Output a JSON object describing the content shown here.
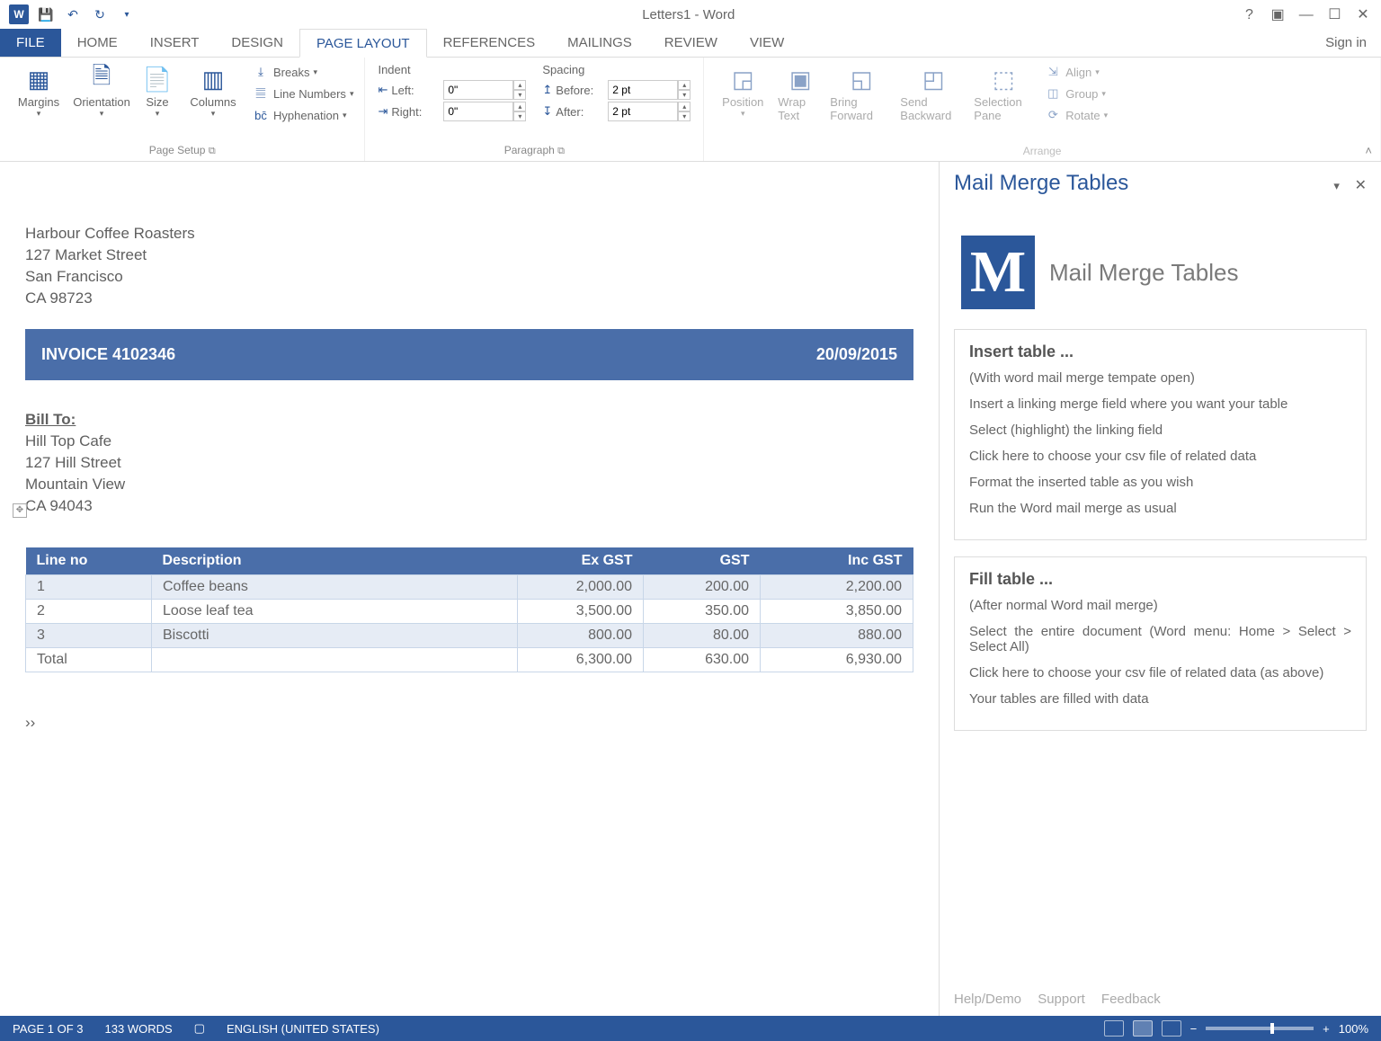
{
  "title": "Letters1 - Word",
  "signin": "Sign in",
  "tabs": [
    "FILE",
    "HOME",
    "INSERT",
    "DESIGN",
    "PAGE LAYOUT",
    "REFERENCES",
    "MAILINGS",
    "REVIEW",
    "VIEW"
  ],
  "active_tab_index": 4,
  "ribbon": {
    "groups": {
      "page_setup": {
        "label": "Page Setup",
        "margins": "Margins",
        "orientation": "Orientation",
        "size": "Size",
        "columns": "Columns",
        "breaks": "Breaks",
        "line_numbers": "Line Numbers",
        "hyphenation": "Hyphenation"
      },
      "paragraph": {
        "label": "Paragraph",
        "indent_label": "Indent",
        "left_label": "Left:",
        "right_label": "Right:",
        "left_value": "0\"",
        "right_value": "0\"",
        "spacing_label": "Spacing",
        "before_label": "Before:",
        "after_label": "After:",
        "before_value": "2 pt",
        "after_value": "2 pt"
      },
      "arrange": {
        "label": "Arrange",
        "position": "Position",
        "wrap": "Wrap Text",
        "forward": "Bring Forward",
        "backward": "Send Backward",
        "selpane": "Selection Pane",
        "align": "Align",
        "group": "Group",
        "rotate": "Rotate"
      }
    }
  },
  "document": {
    "sender": [
      "Harbour Coffee Roasters",
      "127 Market Street",
      "San Francisco",
      "CA 98723"
    ],
    "invoice_label": "INVOICE 4102346",
    "invoice_date": "20/09/2015",
    "bill_to_label": "Bill To:",
    "bill_to": [
      "Hill Top Cafe",
      "127 Hill Street",
      "Mountain View",
      "CA 94043"
    ],
    "table": {
      "headers": [
        "Line no",
        "Description",
        "Ex GST",
        "GST",
        "Inc GST"
      ],
      "rows": [
        [
          "1",
          "Coffee beans",
          "2,000.00",
          "200.00",
          "2,200.00"
        ],
        [
          "2",
          "Loose leaf tea",
          "3,500.00",
          "350.00",
          "3,850.00"
        ],
        [
          "3",
          "Biscotti",
          "800.00",
          "80.00",
          "880.00"
        ],
        [
          "Total",
          "",
          "6,300.00",
          "630.00",
          "6,930.00"
        ]
      ]
    }
  },
  "task_pane": {
    "title": "Mail Merge Tables",
    "logo_title": "Mail Merge Tables",
    "box1": {
      "heading": "Insert table ...",
      "lines": [
        "(With word mail merge tempate open)",
        "Insert a linking merge field where you want your table",
        "Select (highlight) the linking field",
        "Click here to choose your csv file of related data",
        "Format the inserted table as you wish",
        "Run the Word mail merge as usual"
      ]
    },
    "box2": {
      "heading": "Fill table ...",
      "lines": [
        "(After normal Word mail merge)",
        "Select the entire document (Word menu: Home > Select > Select All)",
        "Click here to choose your csv file of related data (as above)",
        "Your tables are filled with data"
      ]
    },
    "footer": [
      "Help/Demo",
      "Support",
      "Feedback"
    ]
  },
  "status": {
    "page": "PAGE 1 OF 3",
    "words": "133 WORDS",
    "lang": "ENGLISH (UNITED STATES)",
    "zoom": "100%"
  }
}
